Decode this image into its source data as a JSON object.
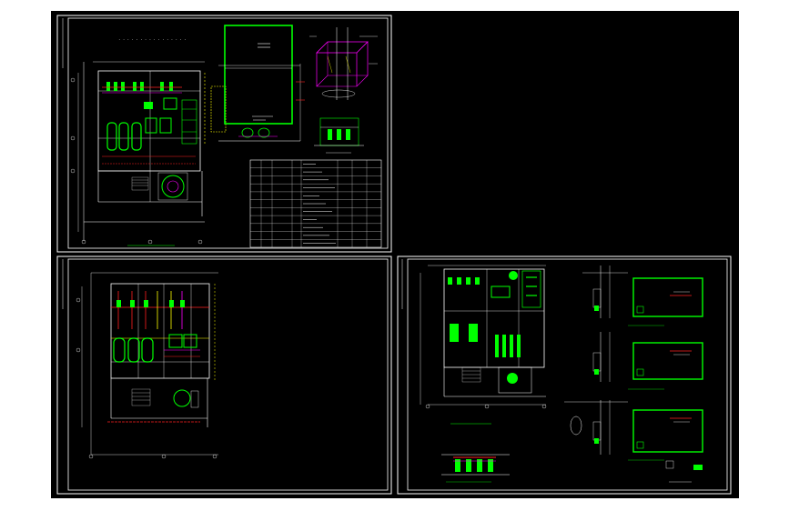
{
  "colors": {
    "background": "#ffffff",
    "modelspace": "#000000",
    "sheet_border": "#ffffff",
    "green": "#00ff00",
    "magenta": "#ff00ff",
    "red": "#ff2020",
    "yellow": "#ffff00",
    "cyan": "#00ffff",
    "white": "#ffffff"
  },
  "sheets": [
    {
      "name": "sheet-top-left",
      "icons": [
        "floor-plan-icon",
        "elevation-box-icon",
        "isometric-tank-icon",
        "equipment-table-icon"
      ]
    },
    {
      "name": "sheet-bottom-left",
      "icons": [
        "floor-plan-icon"
      ]
    },
    {
      "name": "sheet-bottom-right",
      "icons": [
        "floor-plan-icon",
        "section-view-icon",
        "pump-elevation-icon"
      ]
    }
  ],
  "equipment_table": {
    "rows": 11,
    "cols": 8
  }
}
